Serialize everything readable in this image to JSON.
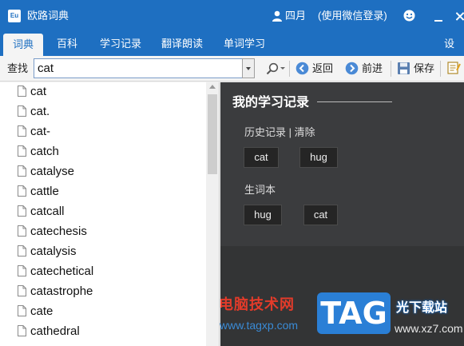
{
  "window": {
    "app_title": "欧路词典",
    "app_logo_text": "Eu",
    "user_name": "四月",
    "login_hint": "(使用微信登录)"
  },
  "tabs": [
    {
      "label": "词典",
      "active": true
    },
    {
      "label": "百科",
      "active": false
    },
    {
      "label": "学习记录",
      "active": false
    },
    {
      "label": "翻译朗读",
      "active": false
    },
    {
      "label": "单词学习",
      "active": false
    }
  ],
  "settings_label": "设置",
  "toolbar": {
    "find_label": "查找",
    "search_value": "cat",
    "back_label": "返回",
    "forward_label": "前进",
    "save_label": "保存"
  },
  "word_list": [
    "cat",
    "cat.",
    "cat-",
    "catch",
    "catalyse",
    "cattle",
    "catcall",
    "catechesis",
    "catalysis",
    "catechetical",
    "catastrophe",
    "cate",
    "cathedral"
  ],
  "panel": {
    "title": "我的学习记录",
    "history_label": "历史记录",
    "separator": "|",
    "clear_label": "清除",
    "history_words": [
      "cat",
      "hug"
    ],
    "vocab_label": "生词本",
    "vocab_words": [
      "hug",
      "cat"
    ]
  },
  "watermark": {
    "cn_text": "电脑技术网",
    "url": "www.tagxp.com",
    "logo_text": "TAG",
    "site_text": "光下载站",
    "url2": "www.xz7.com"
  },
  "colors": {
    "titlebar_blue": "#1e6fc1",
    "panel_bg": "#333435",
    "panel_top_bg": "#3b3c3e",
    "chip_bg": "#252525",
    "watermark_red": "#e23b2a"
  }
}
